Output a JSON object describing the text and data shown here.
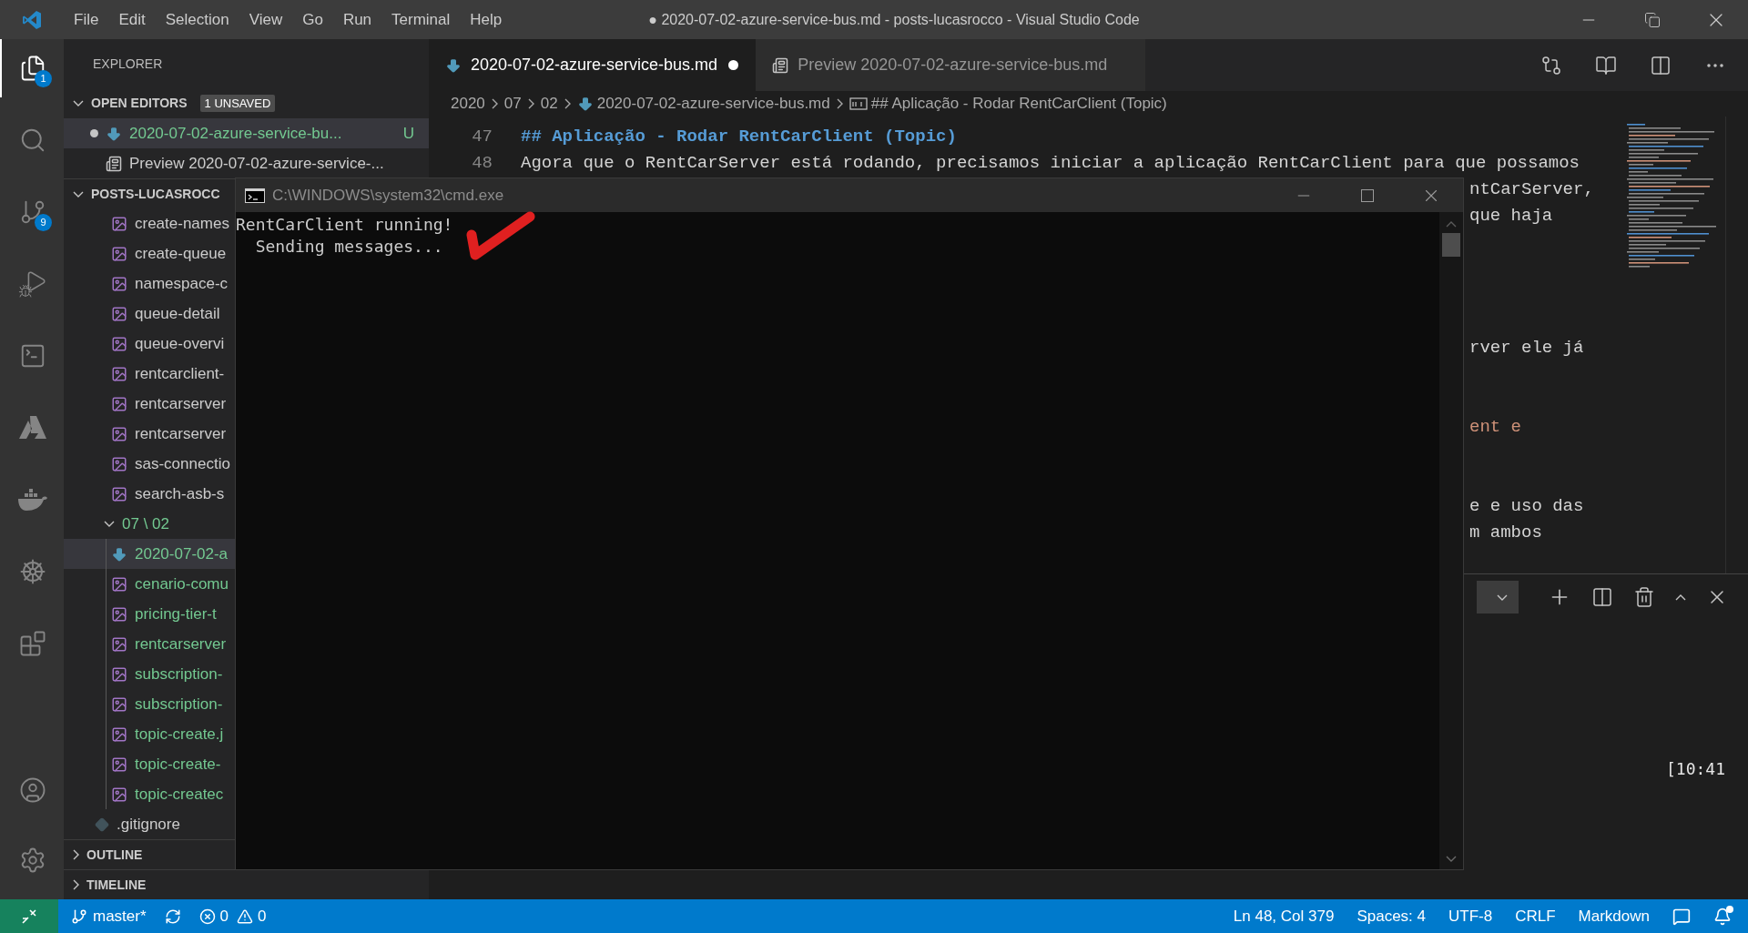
{
  "title_bar": {
    "menu": [
      "File",
      "Edit",
      "Selection",
      "View",
      "Go",
      "Run",
      "Terminal",
      "Help"
    ],
    "title": "● 2020-07-02-azure-service-bus.md - posts-lucasrocco - Visual Studio Code"
  },
  "activity_bar": {
    "top": [
      {
        "kind": "explorer",
        "selected": true,
        "badge": "1"
      },
      {
        "kind": "search",
        "selected": false
      },
      {
        "kind": "source_control",
        "selected": false,
        "badge": "9"
      },
      {
        "kind": "run",
        "selected": false
      },
      {
        "kind": "remote",
        "selected": false
      },
      {
        "kind": "azure",
        "selected": false
      },
      {
        "kind": "docker",
        "selected": false
      },
      {
        "kind": "kubernetes",
        "selected": false
      },
      {
        "kind": "extensions",
        "selected": false
      }
    ],
    "bottom": [
      {
        "kind": "account",
        "selected": false
      },
      {
        "kind": "settings",
        "selected": false
      }
    ]
  },
  "sidebar": {
    "title": "EXPLORER",
    "open_editors": {
      "title": "OPEN EDITORS",
      "badge": "1 UNSAVED",
      "expanded": true,
      "items": [
        {
          "kind": "markdown",
          "name": "2020-07-02-azure-service-bu...",
          "dirty": true,
          "untracked": true,
          "status": "U",
          "selected": true
        },
        {
          "kind": "preview",
          "name": "Preview 2020-07-02-azure-service-...",
          "dirty": false,
          "untracked": false,
          "selected": false
        }
      ]
    },
    "folder": {
      "title": "POSTS-LUCASROCC",
      "expanded": true,
      "items": [
        {
          "kind": "image",
          "name": "create-names",
          "untracked": false,
          "selected": false
        },
        {
          "kind": "image",
          "name": "create-queue",
          "untracked": false,
          "selected": false
        },
        {
          "kind": "image",
          "name": "namespace-c",
          "untracked": false,
          "selected": false
        },
        {
          "kind": "image",
          "name": "queue-detail",
          "untracked": false,
          "selected": false
        },
        {
          "kind": "image",
          "name": "queue-overvi",
          "untracked": false,
          "selected": false
        },
        {
          "kind": "image",
          "name": "rentcarclient-",
          "untracked": false,
          "selected": false
        },
        {
          "kind": "image",
          "name": "rentcarserver",
          "untracked": false,
          "selected": false
        },
        {
          "kind": "image",
          "name": "rentcarserver",
          "untracked": false,
          "selected": false
        },
        {
          "kind": "image",
          "name": "sas-connectio",
          "untracked": false,
          "selected": false
        },
        {
          "kind": "image",
          "name": "search-asb-s",
          "untracked": false,
          "selected": false
        },
        {
          "kind": "folder",
          "name": "07 \\ 02",
          "untracked": true,
          "expanded": true,
          "selected": false,
          "children": [
            {
              "kind": "markdown",
              "name": "2020-07-02-a",
              "untracked": true,
              "selected": true
            },
            {
              "kind": "image",
              "name": "cenario-comu",
              "untracked": true,
              "selected": false
            },
            {
              "kind": "image",
              "name": "pricing-tier-t",
              "untracked": true,
              "selected": false
            },
            {
              "kind": "image",
              "name": "rentcarserver",
              "untracked": true,
              "selected": false
            },
            {
              "kind": "image",
              "name": "subscription-",
              "untracked": true,
              "selected": false
            },
            {
              "kind": "image",
              "name": "subscription-",
              "untracked": true,
              "selected": false
            },
            {
              "kind": "image",
              "name": "topic-create.j",
              "untracked": true,
              "selected": false
            },
            {
              "kind": "image",
              "name": "topic-create-",
              "untracked": true,
              "selected": false
            },
            {
              "kind": "image",
              "name": "topic-createc",
              "untracked": true,
              "selected": false
            }
          ]
        },
        {
          "kind": "git",
          "name": ".gitignore",
          "untracked": false,
          "selected": false
        }
      ]
    },
    "sections": [
      {
        "title": "OUTLINE",
        "expanded": false
      },
      {
        "title": "TIMELINE",
        "expanded": false
      }
    ]
  },
  "tabs": [
    {
      "kind": "markdown",
      "label": "2020-07-02-azure-service-bus.md",
      "dirty": true,
      "selected": true
    },
    {
      "kind": "preview",
      "label": "Preview 2020-07-02-azure-service-bus.md",
      "dirty": false,
      "selected": false
    }
  ],
  "breadcrumb": [
    "2020",
    "07",
    "02",
    "2020-07-02-azure-service-bus.md",
    "## Aplicação - Rodar RentCarClient (Topic)"
  ],
  "editor": {
    "lines": [
      {
        "number": "47",
        "kind": "heading",
        "text": "## Aplicação - Rodar RentCarClient (Topic)"
      },
      {
        "number": "48",
        "kind": "text",
        "text": "Agora que o RentCarServer está rodando, precisamos iniciar a aplicação RentCarClient para que possamos"
      }
    ],
    "wrapped": [
      {
        "kind": "text",
        "text": "ntCarServer,"
      },
      {
        "kind": "text",
        "text": "que haja"
      },
      {
        "kind": "blank"
      },
      {
        "kind": "blank"
      },
      {
        "kind": "blank"
      },
      {
        "kind": "blank"
      },
      {
        "kind": "text",
        "text": "rver ele já"
      },
      {
        "kind": "blank"
      },
      {
        "kind": "blank"
      },
      {
        "kind": "link",
        "text": "ent e"
      },
      {
        "kind": "blank"
      },
      {
        "kind": "blank"
      },
      {
        "kind": "text",
        "text": "e e uso das"
      },
      {
        "kind": "text",
        "text": "m ambos"
      }
    ]
  },
  "panel": {
    "output": "[10:41"
  },
  "cmd": {
    "title": "C:\\WINDOWS\\system32\\cmd.exe",
    "lines": [
      "RentCarClient running!",
      "  Sending messages..."
    ]
  },
  "status_bar": {
    "branch": "master*",
    "errors": "0",
    "warnings": "0",
    "right": [
      "Ln 48, Col 379",
      "Spaces: 4",
      "UTF-8",
      "CRLF",
      "Markdown"
    ],
    "notification": true
  }
}
